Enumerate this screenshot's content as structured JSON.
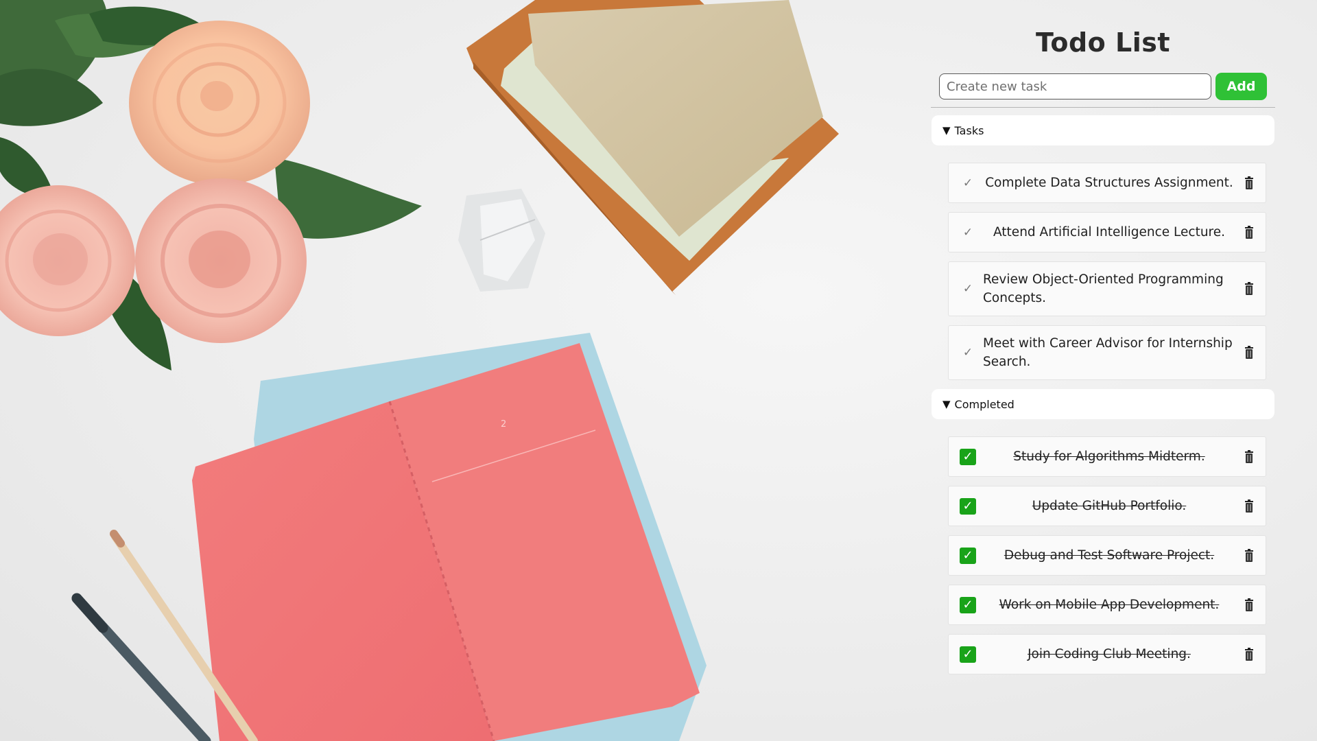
{
  "app": {
    "title": "Todo List",
    "input_placeholder": "Create new task",
    "input_value": "",
    "add_label": "Add"
  },
  "sections": {
    "tasks": {
      "label": "Tasks",
      "caret": "▼",
      "items": [
        {
          "text": "Complete Data Structures Assignment.",
          "done": false
        },
        {
          "text": "Attend Artificial Intelligence Lecture.",
          "done": false
        },
        {
          "text": "Review Object-Oriented Programming Concepts.",
          "done": false
        },
        {
          "text": "Meet with Career Advisor for Internship Search.",
          "done": false
        }
      ]
    },
    "completed": {
      "label": "Completed",
      "caret": "▼",
      "items": [
        {
          "text": "Study for Algorithms Midterm.",
          "done": true
        },
        {
          "text": "Update GitHub Portfolio.",
          "done": true
        },
        {
          "text": "Debug and Test Software Project.",
          "done": true
        },
        {
          "text": "Work on Mobile App Development.",
          "done": true
        },
        {
          "text": "Join Coding Club Meeting.",
          "done": true
        }
      ]
    }
  },
  "icons": {
    "check_open": "✓",
    "check_done": "✓",
    "trash": "trash-icon"
  },
  "colors": {
    "add_button": "#2fc136",
    "check_done": "#19a319",
    "title": "#2b2b2b"
  },
  "background": {
    "notebook_page_number": "2"
  }
}
